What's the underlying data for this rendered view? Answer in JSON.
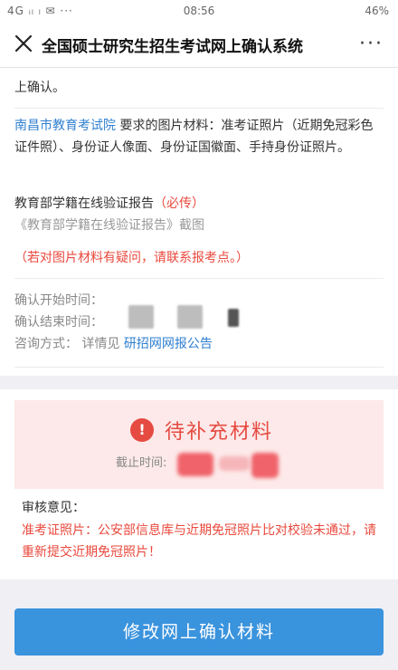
{
  "status_bar": {
    "signal": "4G ᵢₗ ₗ ✉ ···",
    "time": "08:56",
    "battery": "46%"
  },
  "nav": {
    "title": "全国硕士研究生招生考试网上确认系统",
    "more": "···"
  },
  "content": {
    "top_line": "上确认。",
    "materials_link": "南昌市教育考试院",
    "materials_text": "要求的图片材料：准考证照片（近期免冠彩色证件照）、身份证人像面、身份证国徽面、手持身份证照片。",
    "report_title": "教育部学籍在线验证报告",
    "report_required": "（必传）",
    "report_screenshot": "《教育部学籍在线验证报告》截图",
    "note": "（若对图片材料有疑问，请联系报考点。）",
    "confirm_start_label": "确认开始时间：",
    "confirm_end_label": "确认结束时间：",
    "consult_label": "咨询方式：",
    "consult_text": "详情见",
    "consult_link": "研招网网报公告"
  },
  "status": {
    "icon_glyph": "!",
    "title": "待补充材料",
    "deadline_label": "截止时间:"
  },
  "review": {
    "label": "审核意见：",
    "text": "准考证照片：公安部信息库与近期免冠照片比对校验未通过，请重新提交近期免冠照片！"
  },
  "action": {
    "button_label": "修改网上确认材料"
  },
  "colors": {
    "accent": "#3a93dd",
    "alert": "#e54b41",
    "link": "#2f7fd0"
  }
}
